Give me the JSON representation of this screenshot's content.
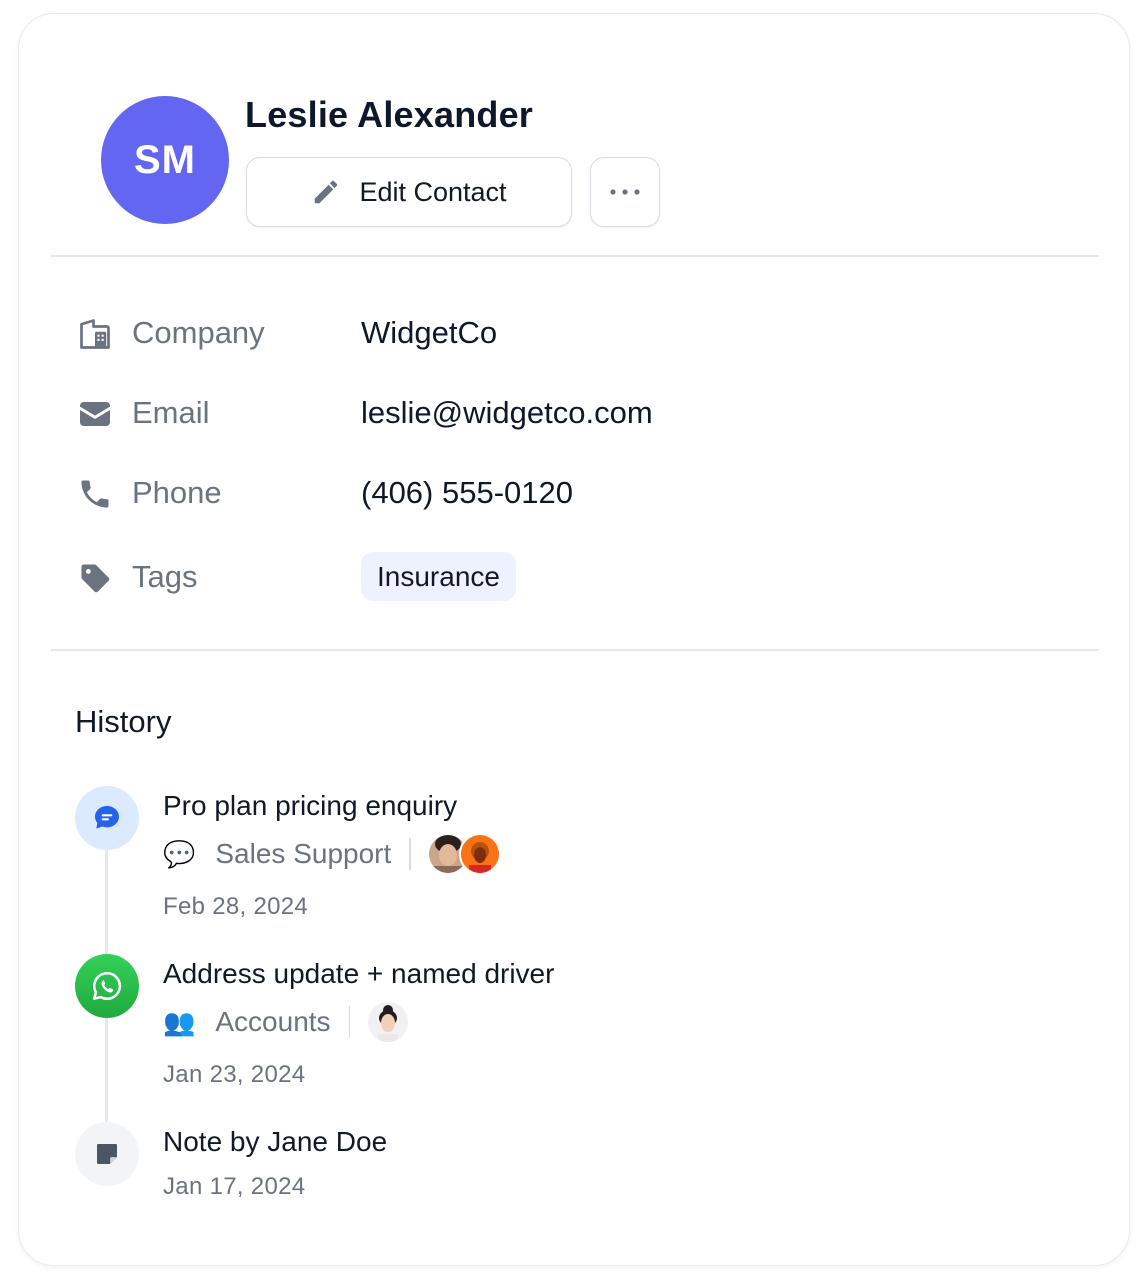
{
  "contact": {
    "initials": "SM",
    "name": "Leslie Alexander",
    "avatar_color": "#6366f1"
  },
  "actions": {
    "edit_label": "Edit Contact",
    "more_label": "···"
  },
  "fields": {
    "company": {
      "label": "Company",
      "value": "WidgetCo",
      "icon": "building-icon"
    },
    "email": {
      "label": "Email",
      "value": "leslie@widgetco.com",
      "icon": "envelope-icon"
    },
    "phone": {
      "label": "Phone",
      "value": "(406) 555-0120",
      "icon": "phone-icon"
    },
    "tags": {
      "label": "Tags",
      "values": [
        "Insurance"
      ],
      "icon": "tag-icon"
    }
  },
  "history": {
    "title": "History",
    "items": [
      {
        "title": "Pro plan pricing enquiry",
        "channel_emoji": "💬",
        "channel": "Sales Support",
        "date": "Feb 28, 2024",
        "icon": "chat-bubble-icon",
        "icon_bg": "#dbeafe",
        "icon_color": "#2563eb",
        "participants": [
          "person-avatar",
          "person-avatar"
        ]
      },
      {
        "title": "Address update + named driver",
        "channel_emoji": "👥",
        "channel": "Accounts",
        "date": "Jan 23, 2024",
        "icon": "whatsapp-icon",
        "icon_bg": "#22c55e",
        "icon_color": "#ffffff",
        "participants": [
          "person-avatar"
        ]
      },
      {
        "title": "Note by Jane Doe",
        "date": "Jan 17, 2024",
        "icon": "sticky-note-icon",
        "icon_bg": "#f3f4f6",
        "icon_color": "#4b5563"
      }
    ]
  }
}
